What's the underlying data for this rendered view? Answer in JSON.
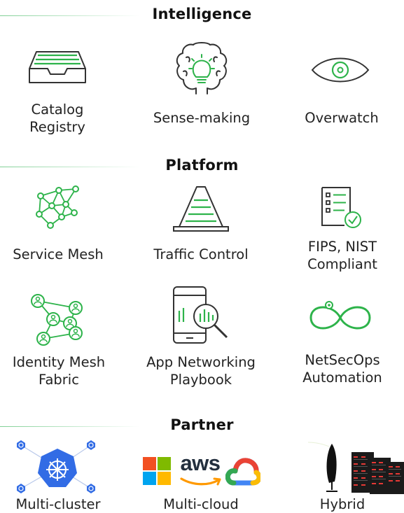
{
  "sections": {
    "intelligence": "Intelligence",
    "platform": "Platform",
    "partner": "Partner"
  },
  "items": {
    "catalog": "Catalog\nRegistry",
    "sense_making": "Sense-making",
    "overwatch": "Overwatch",
    "service_mesh": "Service Mesh",
    "traffic_control": "Traffic Control",
    "fips_nist": "FIPS, NIST\nCompliant",
    "identity_mesh": "Identity Mesh\nFabric",
    "app_networking": "App Networking\nPlaybook",
    "netsecops": "NetSecOps\nAutomation",
    "multi_cluster": "Multi-cluster",
    "multi_cloud": "Multi-cloud",
    "hybrid": "Hybrid"
  },
  "logos": {
    "aws": "aws"
  },
  "colors": {
    "accent": "#2db34a",
    "text": "#222222",
    "kubernetes": "#326ce5"
  }
}
